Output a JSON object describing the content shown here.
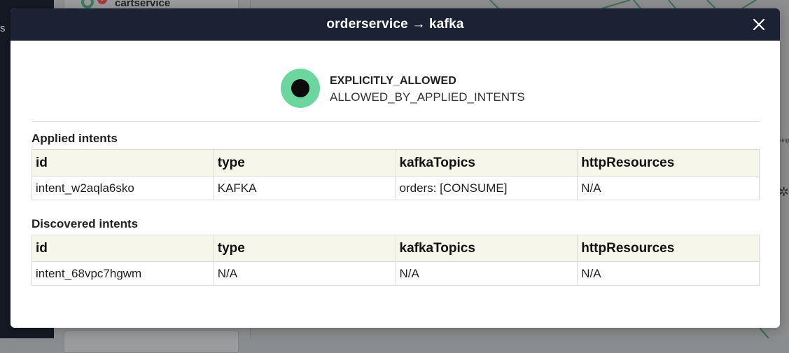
{
  "background": {
    "sidebar_fragment": "s",
    "card_title": "cartservice",
    "badge": "!"
  },
  "modal": {
    "title": "orderservice → kafka",
    "close_icon": "close-icon",
    "status": {
      "main": "EXPLICITLY_ALLOWED",
      "sub": "ALLOWED_BY_APPLIED_INTENTS",
      "color": "#6bd69e"
    },
    "applied": {
      "title": "Applied intents",
      "headers": [
        "id",
        "type",
        "kafkaTopics",
        "httpResources"
      ],
      "rows": [
        [
          "intent_w2aqla6sko",
          "KAFKA",
          "orders: [CONSUME]",
          "N/A"
        ]
      ]
    },
    "discovered": {
      "title": "Discovered intents",
      "headers": [
        "id",
        "type",
        "kafkaTopics",
        "httpResources"
      ],
      "rows": [
        [
          "intent_68vpc7hgwm",
          "N/A",
          "N/A",
          "N/A"
        ]
      ]
    }
  },
  "colors": {
    "header_bg": "#1a2233",
    "table_header_bg": "#f7f6ea"
  }
}
